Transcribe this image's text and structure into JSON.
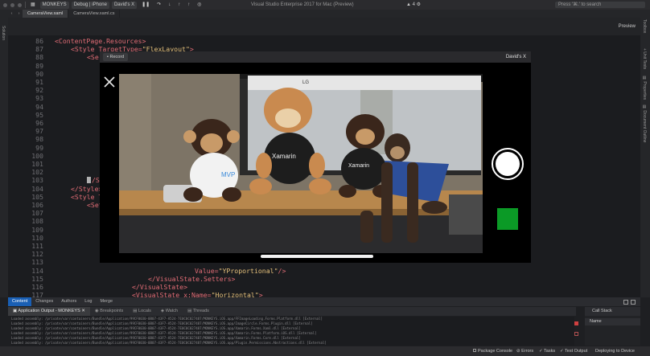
{
  "titlebar": {
    "project": "MONKEYS",
    "config": "Debug | iPhone",
    "device": "David's X",
    "vs_title": "Visual Studio Enterprise 2017 for Mac (Preview)",
    "warning": "4",
    "search_placeholder": "Press '⌘.' to search"
  },
  "tabs": [
    {
      "label": "CameraView.xaml"
    },
    {
      "label": "CameraView.xaml.cs"
    }
  ],
  "editor": {
    "preview_label": "Preview",
    "lines": [
      {
        "n": "86",
        "code": "<ContentPage.Resources>"
      },
      {
        "n": "87",
        "code": "<Style TargetType=\"FlexLayout\">"
      },
      {
        "n": "88",
        "code": "<Se"
      },
      {
        "n": "89",
        "code": ""
      },
      {
        "n": "90",
        "code": ""
      },
      {
        "n": "91",
        "code": ""
      },
      {
        "n": "92",
        "code": ""
      },
      {
        "n": "93",
        "code": ""
      },
      {
        "n": "94",
        "code": ""
      },
      {
        "n": "95",
        "code": ""
      },
      {
        "n": "96",
        "code": ""
      },
      {
        "n": "97",
        "code": ""
      },
      {
        "n": "98",
        "code": ""
      },
      {
        "n": "99",
        "code": ""
      },
      {
        "n": "100",
        "code": ""
      },
      {
        "n": "101",
        "code": ""
      },
      {
        "n": "102",
        "code": ""
      },
      {
        "n": "103",
        "code": "/Se"
      },
      {
        "n": "104",
        "code": "</Style>"
      },
      {
        "n": "105",
        "code": "<Style T"
      },
      {
        "n": "106",
        "code": "<Set"
      },
      {
        "n": "107",
        "code": ""
      },
      {
        "n": "108",
        "code": ""
      },
      {
        "n": "109",
        "code": ""
      },
      {
        "n": "110",
        "code": ""
      },
      {
        "n": "111",
        "code": ""
      },
      {
        "n": "112",
        "code": ""
      },
      {
        "n": "113",
        "code": ""
      },
      {
        "n": "114",
        "code": "Value=\"YProportional\"/>"
      },
      {
        "n": "115",
        "code": "</VisualState.Setters>"
      },
      {
        "n": "116",
        "code": "</VisualState>"
      },
      {
        "n": "117",
        "code": "<VisualState x:Name=\"Horizontal\">"
      }
    ]
  },
  "camera": {
    "record_label": "Record",
    "title": "David's X",
    "scene": {
      "jersey_text_1": "MVP",
      "jersey_text_2": "Xamarin",
      "jersey_text_3": "Xamarin",
      "monitor_brand": "LG"
    }
  },
  "bottom_tabs": [
    "Content",
    "Changes",
    "Authors",
    "Log",
    "Merge"
  ],
  "pad_tabs": [
    "Application Output - MONKEYS",
    "Breakpoints",
    "Locals",
    "Watch",
    "Threads"
  ],
  "output_lines": [
    "Loaded assembly: /private/var/containers/Bundle/Application/99CF0030-0B07-43F7-A524-7E0C0C027487/MONKEYS.iOS.app/FFImageLoading.Forms.Platform.dll [External]",
    "Loaded assembly: /private/var/containers/Bundle/Application/99CF0030-0B07-43F7-A524-7E0C0C027487/MONKEYS.iOS.app/ImageCircle.Forms.Plugin.dll [External]",
    "Loaded assembly: /private/var/containers/Bundle/Application/99CF0030-0B07-43F7-A524-7E0C0C027487/MONKEYS.iOS.app/Xamarin.Forms.Xaml.dll [External]",
    "Loaded assembly: /private/var/containers/Bundle/Application/99CF0030-0B07-43F7-A524-7E0C0C027487/MONKEYS.iOS.app/Xamarin.Forms.Platform.iOS.dll [External]",
    "Loaded assembly: /private/var/containers/Bundle/Application/99CF0030-0B07-43F7-A524-7E0C0C027487/MONKEYS.iOS.app/Xamarin.Forms.Core.dll [External]",
    "Loaded assembly: /private/var/containers/Bundle/Application/99CF0030-0B07-43F7-A524-7E0C0C027487/MONKEYS.iOS.app/Plugin.Permissions.Abstractions.dll [External]",
    "Loaded assembly: /private/var/containers/Bundle/Application/99CF0030-0B07-43F7-A524-7E0C0C027487/MONKEYS.iOS.app/Monkeys.dll [External]"
  ],
  "callstack": {
    "title": "Call Stack",
    "column": "Name"
  },
  "status": {
    "package_console": "Package Console",
    "errors": "Errors",
    "tasks": "Tasks",
    "test_output": "Test Output",
    "deploying": "Deploying to Device"
  },
  "colors": {
    "accent": "#1a5fb4",
    "green_square": "#0b9a26"
  }
}
